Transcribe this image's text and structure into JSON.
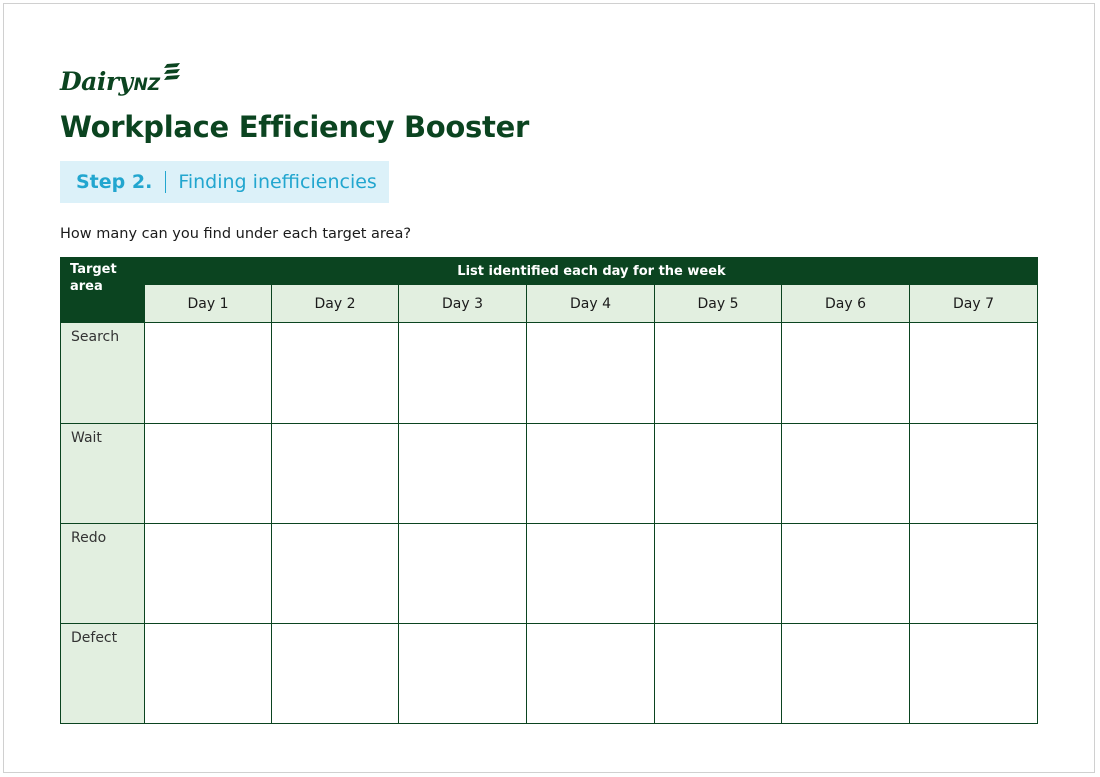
{
  "brand": {
    "name": "Dairy",
    "name_suffix": "NZ"
  },
  "title": "Workplace Efficiency Booster",
  "step": {
    "number": "Step 2.",
    "label": "Finding inefficiencies"
  },
  "prompt": "How many can you find under each target area?",
  "table": {
    "corner_header": "Target area",
    "group_header": "List identified each day for the week",
    "days": [
      "Day 1",
      "Day 2",
      "Day 3",
      "Day 4",
      "Day 5",
      "Day 6",
      "Day 7"
    ],
    "rows": [
      "Search",
      "Wait",
      "Redo",
      "Defect"
    ]
  },
  "colors": {
    "brand_green": "#0b4420",
    "accent_cyan": "#22a6cf",
    "step_bg": "#dcf1f9",
    "header_bg": "#e2efe0"
  },
  "icons": {
    "logo_mark": "dairynz-stripes-icon"
  }
}
